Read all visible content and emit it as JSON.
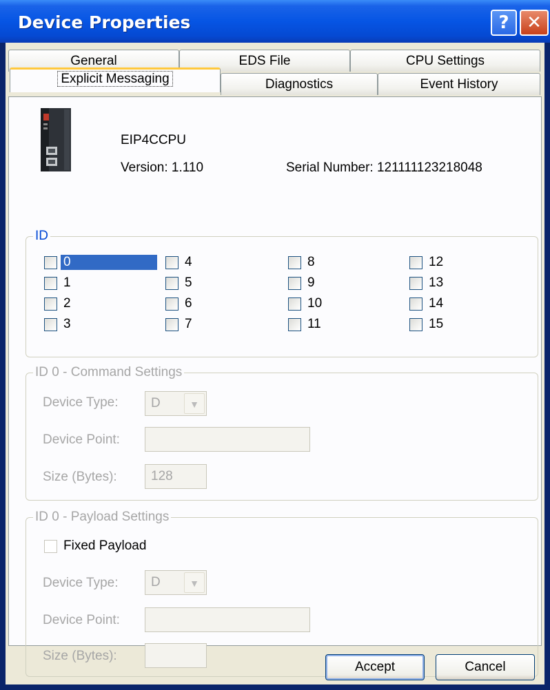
{
  "window": {
    "title": "Device Properties",
    "help_glyph": "?",
    "close_glyph": "✕"
  },
  "tabs_row1": [
    "General",
    "EDS File",
    "CPU Settings"
  ],
  "tabs_row2": [
    "Explicit Messaging",
    "Diagnostics",
    "Event History"
  ],
  "device": {
    "name": "EIP4CCPU",
    "version": "Version: 1.110",
    "serial": "Serial Number: 121111123218048",
    "image_icon": "plc-cpu-module-icon"
  },
  "id_group": {
    "legend": "ID",
    "ids": [
      "0",
      "1",
      "2",
      "3",
      "4",
      "5",
      "6",
      "7",
      "8",
      "9",
      "10",
      "11",
      "12",
      "13",
      "14",
      "15"
    ],
    "selected": "0"
  },
  "command_settings": {
    "legend": "ID 0 - Command Settings",
    "device_type_label": "Device Type:",
    "device_type_value": "D",
    "device_point_label": "Device Point:",
    "device_point_value": "",
    "size_label": "Size (Bytes):",
    "size_value": "128"
  },
  "payload_settings": {
    "legend": "ID 0 - Payload Settings",
    "fixed_payload_label": "Fixed Payload",
    "device_type_label": "Device Type:",
    "device_type_value": "D",
    "device_point_label": "Device Point:",
    "device_point_value": "",
    "size_label": "Size (Bytes):",
    "size_value": ""
  },
  "buttons": {
    "accept": "Accept",
    "cancel": "Cancel"
  },
  "colors": {
    "title_bar": "#0655e4",
    "panel_bg": "#fcfcfe",
    "dialog_bg": "#ece9d8",
    "selection": "#316ac5",
    "active_tab_accent": "#ffc83c"
  }
}
